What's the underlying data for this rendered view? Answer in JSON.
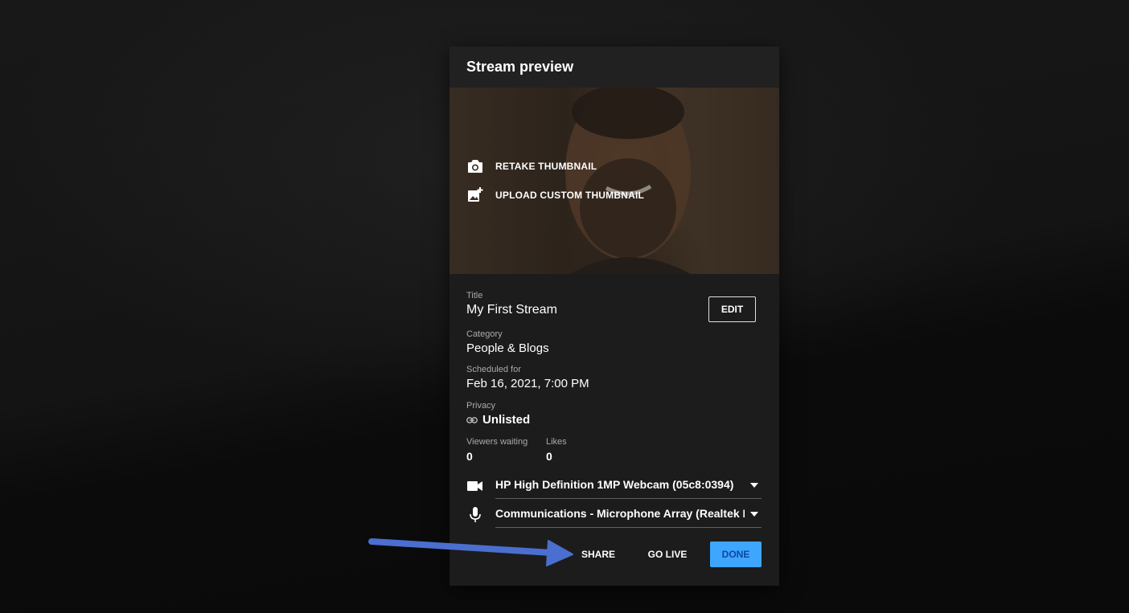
{
  "dialog": {
    "title": "Stream preview",
    "thumbnail_actions": {
      "retake": "RETAKE THUMBNAIL",
      "upload": "UPLOAD CUSTOM THUMBNAIL"
    },
    "title_label": "Title",
    "title_value": "My First Stream",
    "edit_label": "EDIT",
    "category_label": "Category",
    "category_value": "People & Blogs",
    "scheduled_label": "Scheduled for",
    "scheduled_value": "Feb 16, 2021, 7:00 PM",
    "privacy_label": "Privacy",
    "privacy_value": "Unlisted",
    "viewers_label": "Viewers waiting",
    "viewers_value": "0",
    "likes_label": "Likes",
    "likes_value": "0",
    "camera_device": "HP High Definition 1MP Webcam (05c8:0394)",
    "microphone_device": "Communications - Microphone Array (Realtek High Definition Audio)",
    "buttons": {
      "share": "SHARE",
      "go_live": "GO LIVE",
      "done": "DONE"
    }
  },
  "colors": {
    "done_button_bg": "#3ea6ff",
    "annotation_arrow": "#4a6fd0",
    "dialog_bg": "#1c1c1c"
  },
  "icons": [
    "camera-icon",
    "add-photo-icon",
    "link-icon",
    "videocam-icon",
    "mic-icon",
    "dropdown-caret-icon",
    "annotation-arrow"
  ]
}
